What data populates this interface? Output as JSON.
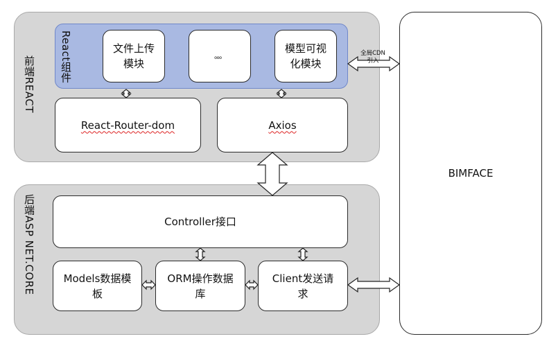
{
  "frontend": {
    "panel_label": "前端REACT",
    "components_label": "React组件",
    "components": [
      {
        "label": "文件上传模块"
      },
      {
        "label": "。。。"
      },
      {
        "label": "模型可视化模块"
      }
    ],
    "router": {
      "label": "React-Router-dom"
    },
    "axios": {
      "label": "Axios"
    }
  },
  "backend": {
    "panel_label": "后端ASP NET.CORE",
    "controller": {
      "label": "Controller接口"
    },
    "models": {
      "label": "Models数据模板"
    },
    "orm": {
      "label": "ORM操作数据库"
    },
    "client": {
      "label": "Client发送请求"
    }
  },
  "bimface": {
    "label": "BIMFACE"
  },
  "connector_note": "全局CDN引入",
  "colors": {
    "panel_bg": "#d6d6d6",
    "group_bg": "#a9b9e2",
    "group_border": "#6f87c9",
    "box_bg": "#ffffff",
    "box_border": "#2a2a2a"
  }
}
